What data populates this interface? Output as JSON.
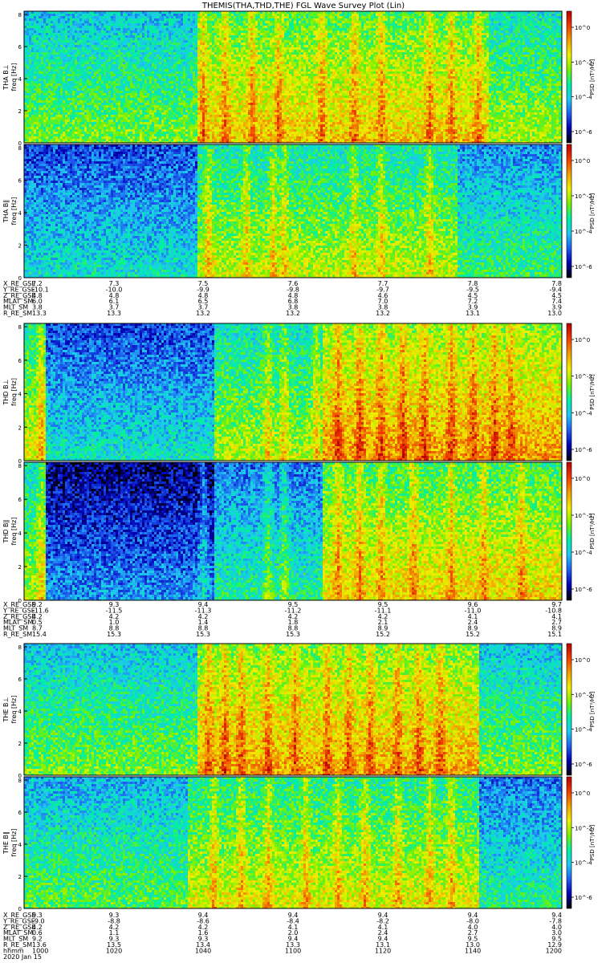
{
  "title": "THEMIS(THA,THD,THE) FGL Wave Survey Plot (Lin)",
  "colorscale": {
    "stops": [
      "#000000",
      "#0000b4",
      "#1e5ef0",
      "#1ec8f0",
      "#00f0a0",
      "#78f000",
      "#f0f000",
      "#f0a000",
      "#f03c00",
      "#b40000"
    ],
    "ticks": [
      "10^0",
      "10^-2",
      "10^-4",
      "10^-6"
    ]
  },
  "chart_data": [
    {
      "type": "heatmap",
      "title": "",
      "ylabel": "THA B⊥",
      "ylabel2": "freq [Hz]",
      "zlabel": "PSD [nT²/Hz]",
      "y_ticks": [
        "0",
        "2",
        "4",
        "6",
        "8"
      ],
      "ylim": [
        0,
        8.2
      ],
      "x_range": [
        0,
        1
      ],
      "base_level": 0.5,
      "events": [
        {
          "x0": 0.0,
          "x1": 0.32,
          "level": 0.45
        },
        {
          "x0": 0.32,
          "x1": 0.86,
          "level": 0.62
        },
        {
          "x0": 0.86,
          "x1": 1.0,
          "level": 0.5
        }
      ],
      "bursts": [
        0.33,
        0.37,
        0.42,
        0.47,
        0.55,
        0.61,
        0.66,
        0.75,
        0.79,
        0.84
      ],
      "seed": 11
    },
    {
      "type": "heatmap",
      "title": "",
      "ylabel": "THA B∥",
      "ylabel2": "freq [Hz]",
      "zlabel": "PSD [nT²/Hz]",
      "y_ticks": [
        "0",
        "2",
        "4",
        "6",
        "8"
      ],
      "ylim": [
        0,
        8.2
      ],
      "x_range": [
        0,
        1
      ],
      "base_level": 0.4,
      "events": [
        {
          "x0": 0.0,
          "x1": 0.32,
          "level": 0.3
        },
        {
          "x0": 0.32,
          "x1": 0.8,
          "level": 0.52
        },
        {
          "x0": 0.8,
          "x1": 1.0,
          "level": 0.38
        }
      ],
      "bursts": [
        0.34,
        0.41,
        0.46,
        0.48,
        0.61,
        0.66,
        0.75
      ],
      "seed": 23
    },
    {
      "type": "heatmap",
      "title": "",
      "ylabel": "THD B⊥",
      "ylabel2": "freq [Hz]",
      "zlabel": "PSD [nT²/Hz]",
      "y_ticks": [
        "0",
        "2",
        "4",
        "6",
        "8"
      ],
      "ylim": [
        0,
        8.2
      ],
      "x_range": [
        0,
        1
      ],
      "base_level": 0.5,
      "events": [
        {
          "x0": 0.0,
          "x1": 0.04,
          "level": 0.55
        },
        {
          "x0": 0.04,
          "x1": 0.35,
          "level": 0.3
        },
        {
          "x0": 0.35,
          "x1": 0.55,
          "level": 0.5
        },
        {
          "x0": 0.55,
          "x1": 1.0,
          "level": 0.68
        }
      ],
      "bursts": [
        0.03,
        0.45,
        0.48,
        0.54,
        0.58,
        0.62,
        0.66,
        0.7,
        0.74,
        0.79,
        0.83,
        0.87,
        0.9
      ],
      "seed": 37
    },
    {
      "type": "heatmap",
      "title": "",
      "ylabel": "THD B∥",
      "ylabel2": "freq [Hz]",
      "zlabel": "PSD [nT²/Hz]",
      "y_ticks": [
        "0",
        "2",
        "4",
        "6",
        "8"
      ],
      "ylim": [
        0,
        8.2
      ],
      "x_range": [
        0,
        1
      ],
      "base_level": 0.45,
      "events": [
        {
          "x0": 0.0,
          "x1": 0.04,
          "level": 0.5
        },
        {
          "x0": 0.04,
          "x1": 0.35,
          "level": 0.18
        },
        {
          "x0": 0.35,
          "x1": 0.55,
          "level": 0.35
        },
        {
          "x0": 0.55,
          "x1": 1.0,
          "level": 0.6
        }
      ],
      "bursts": [
        0.03,
        0.33,
        0.45,
        0.48,
        0.58,
        0.62,
        0.66,
        0.72,
        0.79,
        0.85,
        0.92
      ],
      "seed": 41
    },
    {
      "type": "heatmap",
      "title": "",
      "ylabel": "THE B⊥",
      "ylabel2": "freq [Hz]",
      "zlabel": "PSD [nT²/Hz]",
      "y_ticks": [
        "0",
        "2",
        "4",
        "6",
        "8"
      ],
      "ylim": [
        0,
        8.2
      ],
      "x_range": [
        0,
        1
      ],
      "base_level": 0.5,
      "events": [
        {
          "x0": 0.0,
          "x1": 0.32,
          "level": 0.45
        },
        {
          "x0": 0.32,
          "x1": 0.84,
          "level": 0.66
        },
        {
          "x0": 0.84,
          "x1": 1.0,
          "level": 0.45
        }
      ],
      "bursts": [
        0.34,
        0.37,
        0.4,
        0.45,
        0.5,
        0.56,
        0.6,
        0.64,
        0.69,
        0.73,
        0.77
      ],
      "seed": 53
    },
    {
      "type": "heatmap",
      "title": "",
      "ylabel": "THE B∥",
      "ylabel2": "freq [Hz]",
      "zlabel": "PSD [nT²/Hz]",
      "y_ticks": [
        "0",
        "2",
        "4",
        "6",
        "8"
      ],
      "ylim": [
        0,
        8.2
      ],
      "x_range": [
        0,
        1
      ],
      "base_level": 0.45,
      "events": [
        {
          "x0": 0.0,
          "x1": 0.3,
          "level": 0.42
        },
        {
          "x0": 0.3,
          "x1": 0.84,
          "level": 0.55
        },
        {
          "x0": 0.84,
          "x1": 1.0,
          "level": 0.35
        }
      ],
      "bursts": [
        0.35,
        0.4,
        0.45,
        0.52,
        0.58,
        0.63,
        0.69,
        0.75,
        0.79
      ],
      "seed": 67
    }
  ],
  "ephemeris_blocks": [
    {
      "rows": [
        {
          "label": "X_RE_GSE",
          "values": [
            "7.2",
            "7.3",
            "7.5",
            "7.6",
            "7.7",
            "7.8",
            "7.8"
          ]
        },
        {
          "label": "Y_RE_GSE",
          "values": [
            "-10.1",
            "-10.0",
            "-9.9",
            "-9.8",
            "-9.7",
            "-9.5",
            "-9.4"
          ]
        },
        {
          "label": "Z_RE_GSE",
          "values": [
            "4.8",
            "4.8",
            "4.8",
            "4.8",
            "4.6",
            "4.5",
            "4.5"
          ]
        },
        {
          "label": "MLAT_SM",
          "values": [
            "6.0",
            "6.1",
            "6.5",
            "6.8",
            "7.0",
            "7.2",
            "7.4"
          ]
        },
        {
          "label": "MLT_SM",
          "values": [
            "3.8",
            "3.7",
            "3.7",
            "3.8",
            "3.8",
            "3.9",
            "3.9"
          ]
        },
        {
          "label": "R_RE_SM",
          "values": [
            "13.3",
            "13.3",
            "13.2",
            "13.2",
            "13.2",
            "13.1",
            "13.0"
          ]
        }
      ]
    },
    {
      "rows": [
        {
          "label": "X_RE_GSE",
          "values": [
            "9.2",
            "9.3",
            "9.4",
            "9.5",
            "9.5",
            "9.6",
            "9.7"
          ]
        },
        {
          "label": "Y_RE_GSE",
          "values": [
            "-11.6",
            "-11.5",
            "-11.3",
            "-11.2",
            "-11.1",
            "-11.0",
            "-10.8"
          ]
        },
        {
          "label": "Z_RE_GSE",
          "values": [
            "4.2",
            "4.2",
            "4.2",
            "4.2",
            "4.2",
            "4.1",
            "4.1"
          ]
        },
        {
          "label": "MLAT_SM",
          "values": [
            "0.5",
            "1.0",
            "1.4",
            "1.8",
            "2.1",
            "2.4",
            "2.7"
          ]
        },
        {
          "label": "MLT_SM",
          "values": [
            "8.7",
            "8.8",
            "8.8",
            "8.8",
            "8.9",
            "8.9",
            "8.9"
          ]
        },
        {
          "label": "R_RE_SM",
          "values": [
            "15.4",
            "15.3",
            "15.3",
            "15.3",
            "15.2",
            "15.2",
            "15.1"
          ]
        }
      ]
    },
    {
      "rows": [
        {
          "label": "X_RE_GSE",
          "values": [
            "9.3",
            "9.3",
            "9.4",
            "9.4",
            "9.4",
            "9.4",
            "9.4"
          ]
        },
        {
          "label": "Y_RE_GSE",
          "values": [
            "-9.0",
            "-8.8",
            "-8.6",
            "-8.4",
            "-8.2",
            "-8.0",
            "-7.8"
          ]
        },
        {
          "label": "Z_RE_GSE",
          "values": [
            "4.2",
            "4.2",
            "4.2",
            "4.1",
            "4.1",
            "4.0",
            "4.0"
          ]
        },
        {
          "label": "MLAT_SM",
          "values": [
            "0.6",
            "1.1",
            "1.6",
            "2.0",
            "2.4",
            "2.7",
            "3.0"
          ]
        },
        {
          "label": "MLT_SM",
          "values": [
            "9.2",
            "9.3",
            "9.3",
            "9.4",
            "9.4",
            "9.5",
            "9.5"
          ]
        },
        {
          "label": "R_RE_SM",
          "values": [
            "13.6",
            "13.5",
            "13.4",
            "13.3",
            "13.1",
            "13.0",
            "12.9"
          ]
        },
        {
          "label": "hhmm",
          "values": [
            "1000",
            "1020",
            "1040",
            "1100",
            "1120",
            "1140",
            "1200"
          ]
        },
        {
          "label": "2020 Jan 15",
          "values": []
        }
      ]
    }
  ]
}
